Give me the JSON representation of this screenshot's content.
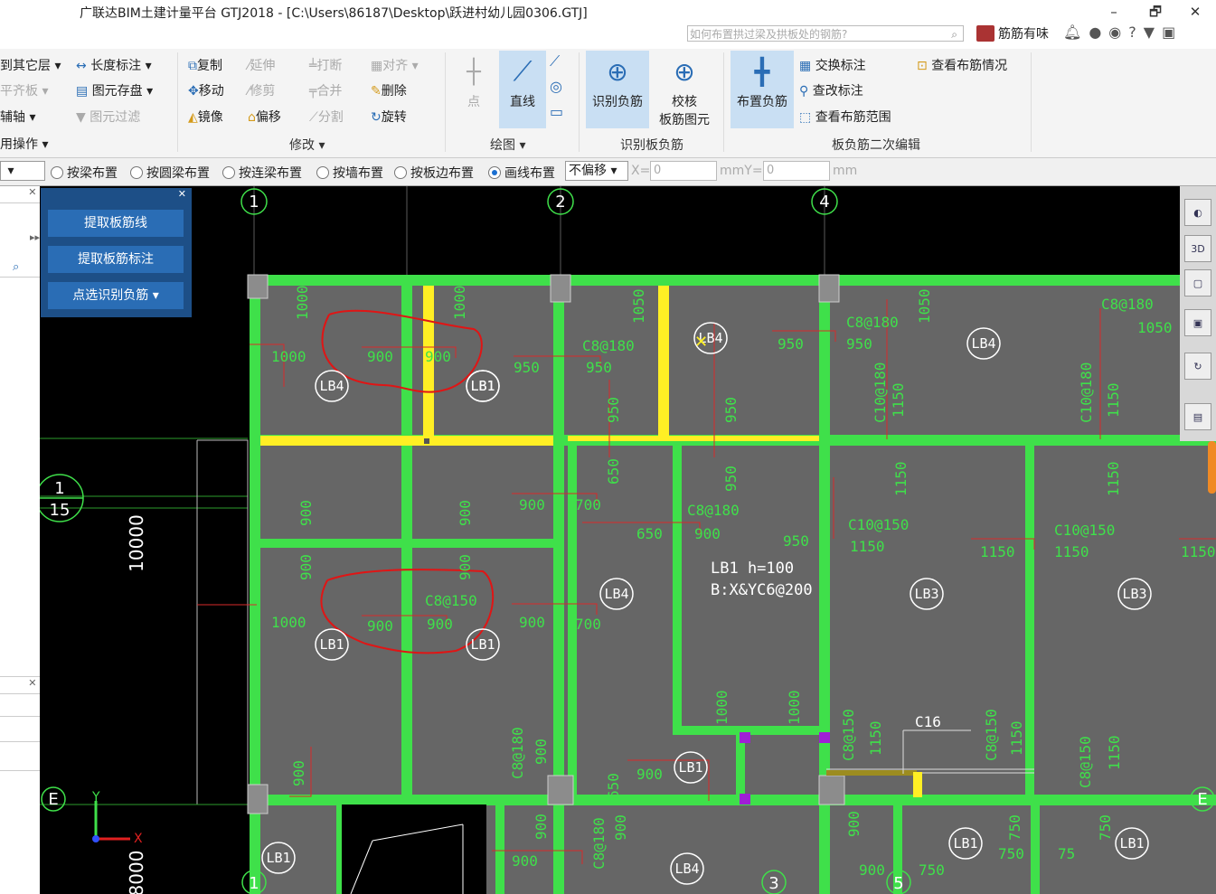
{
  "window": {
    "title": "广联达BIM土建计量平台 GTJ2018 - [C:\\Users\\86187\\Desktop\\跃进村幼儿园0306.GTJ]",
    "minimize": "–",
    "restore": "🗗",
    "close": "✕",
    "search_placeholder": "如何布置拱过梁及拱板处的钢筋?",
    "user_name": "筋筋有味",
    "top_icons": [
      "bell-icon",
      "chat-icon",
      "bot-icon",
      "help-icon",
      "shirt-icon",
      "panel-icon"
    ]
  },
  "ribbon": {
    "col1": [
      "到其它层",
      "平齐板",
      "辅轴",
      "用操作"
    ],
    "col2": [
      "长度标注",
      "图元存盘",
      "图元过滤"
    ],
    "modify": [
      "复制",
      "延伸",
      "打断",
      "对齐",
      "移动",
      "修剪",
      "合并",
      "删除",
      "镜像",
      "偏移",
      "分割",
      "旋转"
    ],
    "modify_group": "修改",
    "draw": {
      "point": "点",
      "line": "直线",
      "group": "绘图"
    },
    "identify": {
      "btn1": "识别负筋",
      "btn2a": "校核",
      "btn2b": "板筋图元",
      "group": "识别板负筋"
    },
    "edit": {
      "place": "布置负筋",
      "swap": "交换标注",
      "check_mark": "查改标注",
      "view_range": "查看布筋范围",
      "view_info": "查看布筋情况",
      "group": "板负筋二次编辑"
    }
  },
  "options": {
    "radios": [
      "按梁布置",
      "按圆梁布置",
      "按连梁布置",
      "按墙布置",
      "按板边布置",
      "画线布置"
    ],
    "selected": "画线布置",
    "offset": "不偏移",
    "x_label": "X=",
    "x_value": "0",
    "mm_y": "mmY=",
    "y_value": "0",
    "mm": "mm"
  },
  "float_panel": {
    "btn1": "提取板筋线",
    "btn2": "提取板筋标注",
    "btn3": "点选识别负筋"
  },
  "drawing": {
    "axis_top": [
      "1",
      "2",
      "4"
    ],
    "axis_bottom": [
      "1",
      "3",
      "5"
    ],
    "axis_side": [
      "E",
      "E"
    ],
    "axis_frac_top": "1",
    "axis_frac_bottom": "15",
    "dim1": "10000",
    "dim2": "8000",
    "slab_note1": "LB1 h=100",
    "slab_note2": "B:X&YC6@200",
    "steel_note": "C16",
    "slabs": [
      "LB4",
      "LB1",
      "LB4",
      "LB4",
      "LB1",
      "LB1",
      "LB4",
      "LB1",
      "LB3",
      "LB3",
      "LB1",
      "LB1",
      "LB4",
      "LB1",
      "LB1"
    ],
    "labels_green": [
      "1000",
      "1000",
      "900",
      "900",
      "1000",
      "1050",
      "950",
      "C8@180",
      "950",
      "950",
      "C8@180",
      "950",
      "1050",
      "C8@180",
      "1050",
      "950",
      "950",
      "C10@180",
      "1150",
      "C10@180",
      "1150",
      "650",
      "950",
      "1150",
      "1150",
      "900",
      "900",
      "900",
      "700",
      "650",
      "C8@180",
      "900",
      "950",
      "C10@150",
      "1150",
      "C10@150",
      "1150",
      "1150",
      "1150",
      "900",
      "900",
      "C8@150",
      "1000",
      "900",
      "900",
      "900",
      "700",
      "1000",
      "1000",
      "C8@150",
      "1150",
      "C8@150",
      "1150",
      "C8@150",
      "1150",
      "900",
      "C8@180",
      "900",
      "650",
      "900",
      "900",
      "C8@180",
      "900",
      "900",
      "900",
      "900",
      "750",
      "750",
      "750",
      "750",
      "75"
    ]
  }
}
